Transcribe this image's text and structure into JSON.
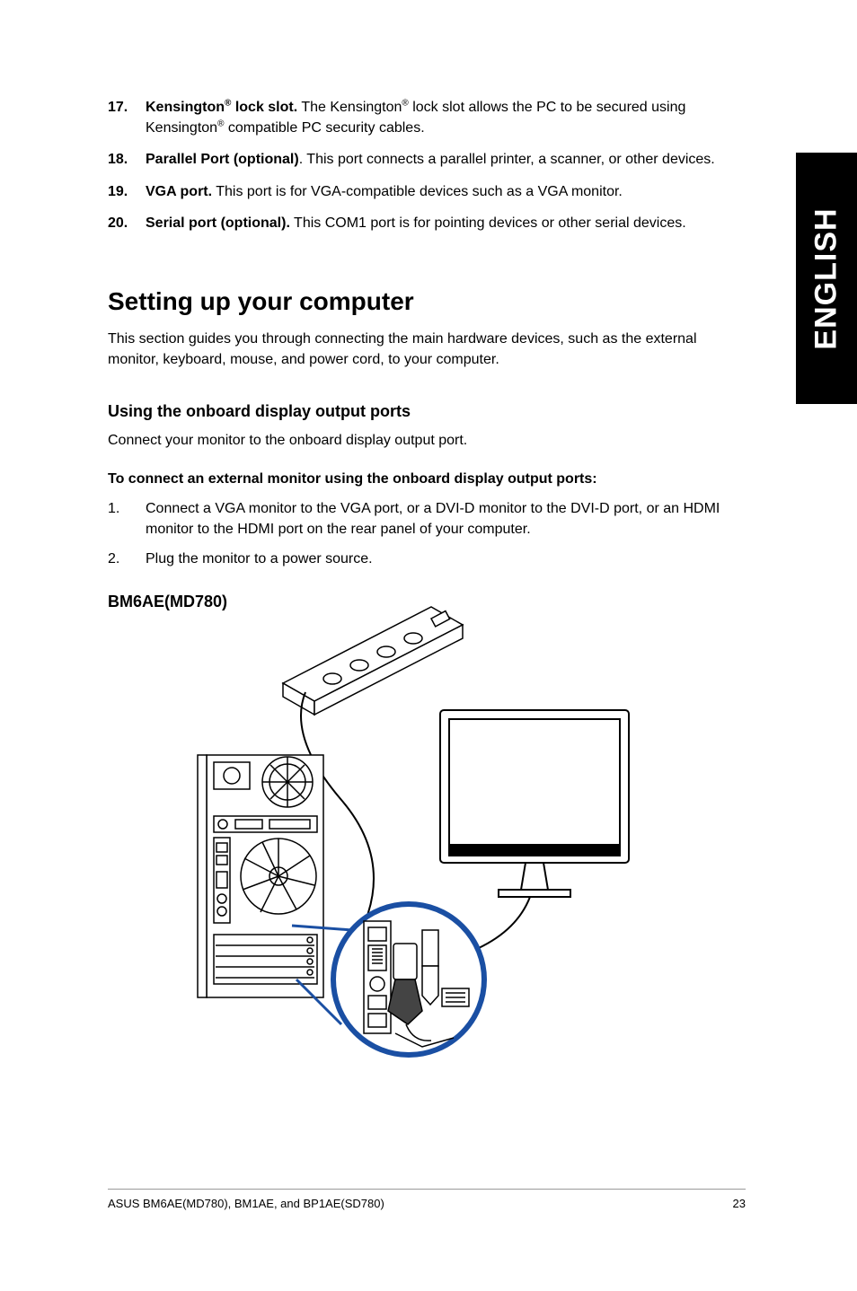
{
  "sideTab": "ENGLISH",
  "items": [
    {
      "num": "17.",
      "boldPrefix": "Kensington",
      "sup1": "®",
      "boldSuffix": " lock slot.",
      "rest": " The Kensington",
      "sup2": "®",
      "rest2": " lock slot allows the PC to be secured using Kensington",
      "sup3": "®",
      "rest3": " compatible PC security cables."
    },
    {
      "num": "18.",
      "bold": "Parallel Port (optional)",
      "rest": ". This port connects a parallel printer, a scanner, or other devices."
    },
    {
      "num": "19.",
      "bold": "VGA port.",
      "rest": " This port is for VGA-compatible devices such as a VGA monitor."
    },
    {
      "num": "20.",
      "bold": "Serial port (optional).",
      "rest": " This COM1 port is for pointing devices or other serial devices."
    }
  ],
  "sectionTitle": "Setting up your computer",
  "sectionPara": "This section guides you through connecting the main hardware devices, such as the external monitor, keyboard, mouse, and power cord, to your computer.",
  "subHeading": "Using the onboard display output ports",
  "subPara": "Connect your monitor to the onboard display output port.",
  "toConnect": "To connect an external monitor using the onboard display output ports:",
  "steps": [
    {
      "n": "1.",
      "t": "Connect a VGA monitor to the VGA port, or a DVI-D monitor to the DVI-D port, or an HDMI monitor to the HDMI port on the rear panel of your computer."
    },
    {
      "n": "2.",
      "t": "Plug the monitor to a power source."
    }
  ],
  "model": "BM6AE(MD780)",
  "footerLeft": "ASUS BM6AE(MD780), BM1AE, and BP1AE(SD780)",
  "footerRight": "23"
}
